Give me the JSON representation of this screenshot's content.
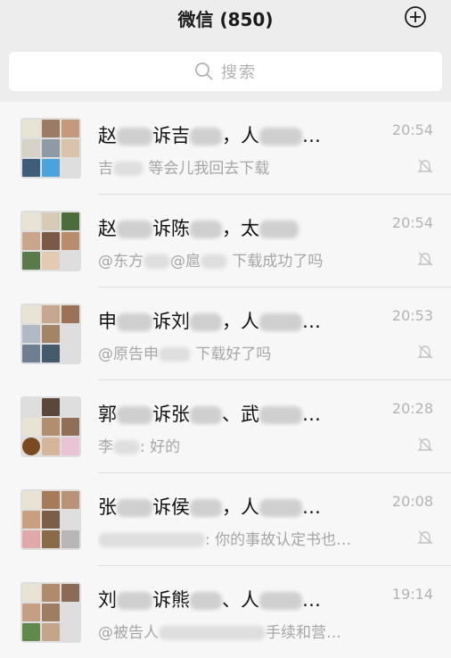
{
  "header": {
    "title": "微信 (850)",
    "add_icon": "plus-circle-icon"
  },
  "search": {
    "placeholder": "搜索",
    "icon": "search-icon"
  },
  "chats": [
    {
      "name_parts": [
        "赵",
        "诉吉",
        "，人",
        "…"
      ],
      "preview_parts": [
        "吉",
        "等会儿我回去下载"
      ],
      "time": "20:54",
      "muted": true
    },
    {
      "name_parts": [
        "赵",
        "诉陈",
        "，太",
        ""
      ],
      "preview_parts": [
        "@东方",
        "@扈",
        "下载成功了吗"
      ],
      "time": "20:54",
      "muted": true
    },
    {
      "name_parts": [
        "申",
        "诉刘",
        "，人",
        "…"
      ],
      "preview_parts": [
        "@原告申",
        "下载好了吗"
      ],
      "time": "20:53",
      "muted": true
    },
    {
      "name_parts": [
        "郭",
        "诉张",
        "、武",
        "…"
      ],
      "preview_parts": [
        "李",
        ": 好的"
      ],
      "time": "20:28",
      "muted": true
    },
    {
      "name_parts": [
        "张",
        "诉侯",
        "，人",
        "…"
      ],
      "preview_parts": [
        "",
        ": 你的事故认定书也…"
      ],
      "time": "20:08",
      "muted": true
    },
    {
      "name_parts": [
        "刘",
        "诉熊",
        "、人",
        "…"
      ],
      "preview_parts": [
        "@被告人",
        "手续和营…"
      ],
      "time": "19:14",
      "muted": false
    }
  ],
  "colors": {
    "background": "#ededed",
    "list": "#f7f7f7",
    "muted_text": "#a6a6a6"
  }
}
